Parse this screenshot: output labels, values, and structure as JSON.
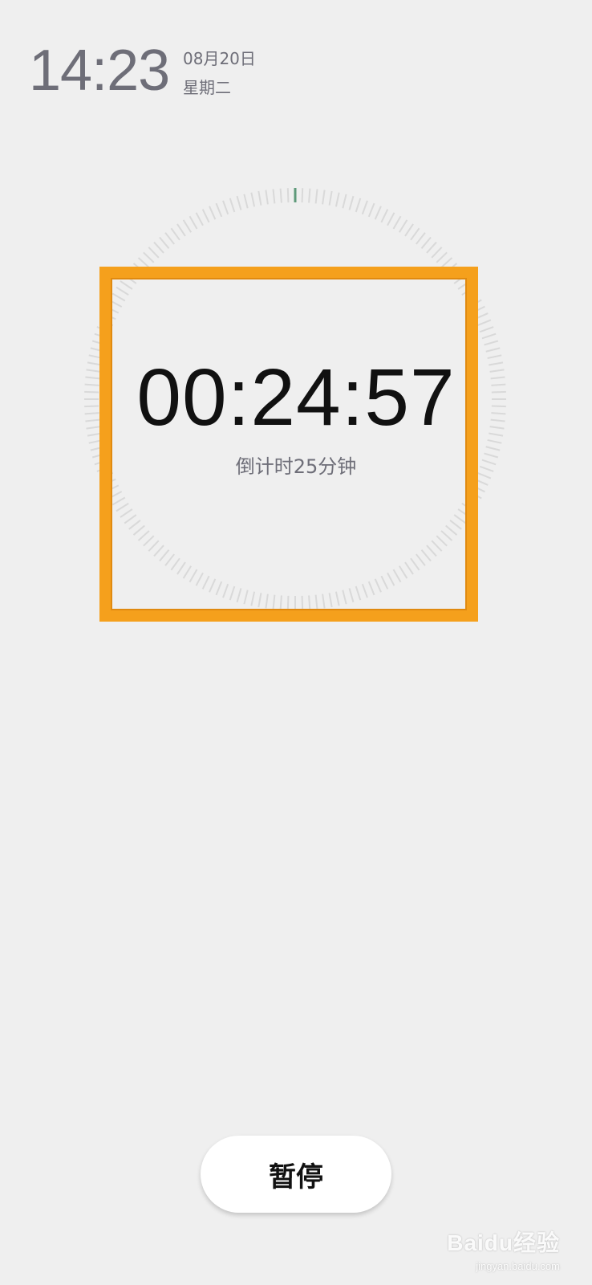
{
  "status": {
    "time": "14:23",
    "date": "08月20日",
    "weekday": "星期二"
  },
  "timer": {
    "remaining": "00:24:57",
    "label": "倒计时25分钟",
    "progress_fraction": 0.0013
  },
  "controls": {
    "pause_label": "暂停"
  },
  "watermark": {
    "logo_text": "Baidu经验",
    "url": "jingyan.baidu.com"
  },
  "colors": {
    "background": "#efefef",
    "highlight_frame": "#f5a01c",
    "progress_tick": "#5e9a7a",
    "tick": "#d9d9d9",
    "secondary_text": "#6e6e78"
  }
}
